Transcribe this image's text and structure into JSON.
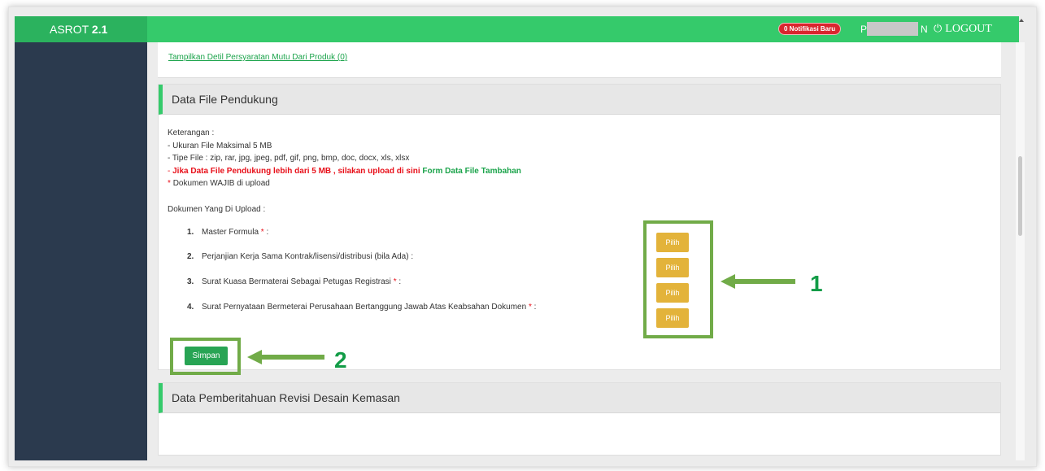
{
  "header": {
    "brand_name": "ASROT",
    "brand_version": "2.1",
    "notification_badge": "0 Notifikasi Baru",
    "user_first": "P",
    "user_last": "N",
    "logout_label": "LOGOUT",
    "logout_icon": "power-icon"
  },
  "top_panel": {
    "detail_link": "Tampilkan Detil Persyaratan Mutu Dari Produk (0)"
  },
  "support_files": {
    "title": "Data File Pendukung",
    "notes_title": "Keterangan :",
    "note_size": "- Ukuran File Maksimal 5 MB",
    "note_types": "- Tipe File : zip, rar, jpg, jpeg, pdf, gif, png, bmp, doc, docx, xls, xlsx",
    "note_large_prefix": "- ",
    "note_large_red": "Jika Data File Pendukung lebih dari 5 MB , silakan upload di sini",
    "note_large_link": "Form Data File Tambahan",
    "note_required_star": "*",
    "note_required": "Dokumen WAJIB di upload",
    "upload_title": "Dokumen Yang Di Upload :",
    "documents": [
      {
        "number": "1.",
        "label": "Master Formula",
        "required": "*",
        "suffix": ":"
      },
      {
        "number": "2.",
        "label": "Perjanjian Kerja Sama Kontrak/lisensi/distribusi (bila Ada) :",
        "required": "",
        "suffix": ""
      },
      {
        "number": "3.",
        "label": "Surat Kuasa Bermaterai Sebagai Petugas Registrasi",
        "required": "*",
        "suffix": ":"
      },
      {
        "number": "4.",
        "label": "Surat Pernyataan Bermeterai Perusahaan Bertanggung Jawab Atas Keabsahan Dokumen",
        "required": "*",
        "suffix": ":"
      }
    ],
    "choose_label": "Pilih",
    "save_label": "Simpan"
  },
  "annotations": {
    "callout_1": "1",
    "callout_2": "2",
    "highlight_color": "#71ab48",
    "callout_color": "#129c47"
  },
  "revision_panel": {
    "title": "Data Pemberitahuan Revisi Desain Kemasan"
  },
  "colors": {
    "topbar": "#35ca6b",
    "sidebar": "#2b3a4e",
    "choose_button": "#e3b33a",
    "save_button": "#28a454",
    "badge": "#d9262e"
  }
}
